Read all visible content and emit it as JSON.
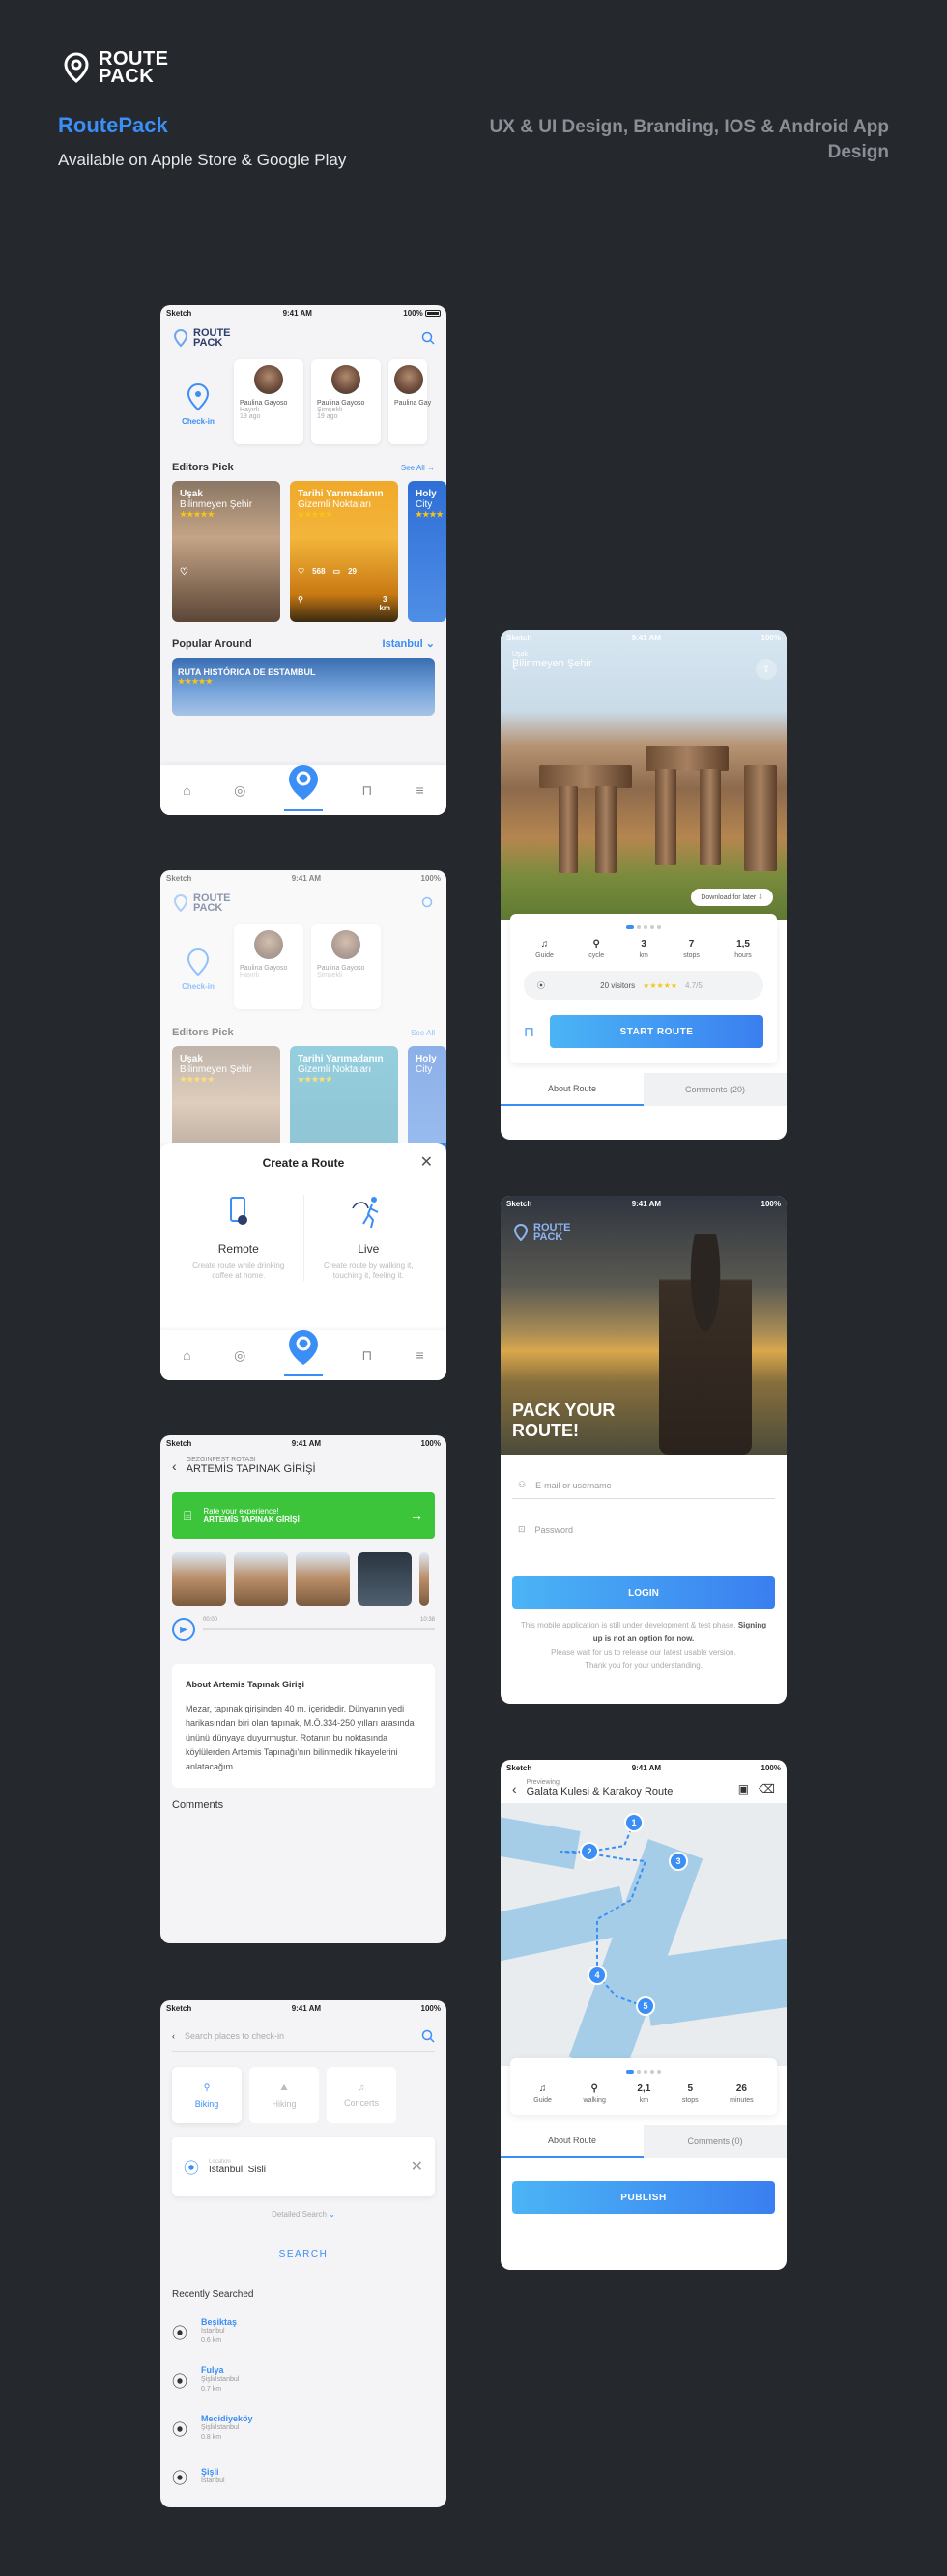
{
  "header": {
    "logo_line1": "ROUTE",
    "logo_line2": "PACK",
    "title": "RoutePack",
    "subtitle": "Available on Apple Store & Google Play",
    "right_text": "UX & UI Design, Branding, IOS & Android App Design"
  },
  "status": {
    "carrier": "Sketch",
    "time": "9:41 AM",
    "battery": "100%"
  },
  "home": {
    "logo_line1": "ROUTE",
    "logo_line2": "PACK",
    "checkin_label": "Check-in",
    "people": [
      {
        "name": "Paulina Gayoso",
        "sub": "Hayırlı",
        "meta": "19 ago"
      },
      {
        "name": "Paulina Gayoso",
        "sub": "Şimşekli",
        "meta": "19 ago"
      },
      {
        "name": "Paulina Gay",
        "sub": "",
        "meta": ""
      }
    ],
    "editors_title": "Editors Pick",
    "see_all": "See All",
    "editors": [
      {
        "title": "Uşak",
        "subtitle": "Bilinmeyen Şehir",
        "stars": "★★★★★",
        "likes": "",
        "comments": "",
        "km": ""
      },
      {
        "title": "Tarihi Yarımadanın",
        "subtitle": "Gizemli Noktaları",
        "stars": "★★★★★",
        "likes": "568",
        "comments": "29",
        "km": "3"
      },
      {
        "title": "Holy",
        "subtitle": "City",
        "stars": "★★★★",
        "likes": "",
        "comments": "",
        "km": ""
      }
    ],
    "km_unit": "km",
    "popular_title": "Popular Around",
    "popular_city": "Istanbul",
    "popular_card_title": "RUTA HISTÓRICA DE ESTAMBUL",
    "popular_stars": "★★★★★"
  },
  "create_route": {
    "title": "Create a Route",
    "remote_label": "Remote",
    "remote_desc": "Create route while drinking coffee at home.",
    "live_label": "Live",
    "live_desc": "Create route by walking it, touching it, feeling it."
  },
  "artemis": {
    "pre": "GEZGINFEST ROTASI",
    "title": "ARTEMİS TAPINAK GİRİŞİ",
    "rate_line1": "Rate your experience!",
    "rate_line2": "ARTEMİS TAPINAK GİRİŞİ",
    "time_start": "00:00",
    "time_end": "10:38",
    "about_title": "About Artemis Tapınak Girişi",
    "about_text": "Mezar, tapınak girişinden 40 m. içeridedir. Dünyanın yedi harikasından biri olan tapınak, M.Ö.334-250 yılları arasında ününü dünyaya duyurmuştur. Rotanın bu noktasında köylülerden Artemis Tapınağı'nın bilinmedik hikayelerini anlatacağım.",
    "comments": "Comments"
  },
  "search": {
    "placeholder": "Search places to check-in",
    "cats": [
      "Biking",
      "Hiking",
      "Concerts"
    ],
    "loc_label": "Location",
    "loc_value": "Istanbul, Sisli",
    "detailed": "Detailed Search",
    "search_btn": "SEARCH",
    "recent_title": "Recently Searched",
    "recent": [
      {
        "name": "Beşiktaş",
        "city": "İstanbul",
        "dist": "0.6 km"
      },
      {
        "name": "Fulya",
        "city": "Şişli/İstanbul",
        "dist": "0.7 km"
      },
      {
        "name": "Mecidiyeköy",
        "city": "Şişli/İstanbul",
        "dist": "0.8 km"
      },
      {
        "name": "Şişli",
        "city": "İstanbul",
        "dist": ""
      }
    ]
  },
  "detail": {
    "pre": "Uşak",
    "title": "Bilinmeyen Şehir",
    "download": "Download for later",
    "stats": [
      {
        "v": "",
        "l": "Guide"
      },
      {
        "v": "",
        "l": "cycle"
      },
      {
        "v": "3",
        "l": "km"
      },
      {
        "v": "7",
        "l": "stops"
      },
      {
        "v": "1,5",
        "l": "hours"
      }
    ],
    "visitors": "20 visitors",
    "rating_stars": "★★★★★",
    "rating": "4.7/5",
    "start": "START ROUTE",
    "tab1": "About Route",
    "tab2": "Comments (20)"
  },
  "login": {
    "logo_line1": "ROUTE",
    "logo_line2": "PACK",
    "headline1": "PACK YOUR",
    "headline2": "ROUTE!",
    "email_placeholder": "E-mail or username",
    "password_placeholder": "Password",
    "login_btn": "LOGIN",
    "note1": "This mobile application is still under development & test phase.",
    "note_bold": "Signing up is not an option for now.",
    "note2": "Please wait for us to release our latest usable version.",
    "note3": "Thank you for your understanding."
  },
  "preview": {
    "pre": "Previewing",
    "title": "Galata Kulesi & Karakoy Route",
    "markers": [
      "1",
      "2",
      "3",
      "4",
      "5"
    ],
    "stats": [
      {
        "v": "",
        "l": "Guide"
      },
      {
        "v": "",
        "l": "walking"
      },
      {
        "v": "2,1",
        "l": "km"
      },
      {
        "v": "5",
        "l": "stops"
      },
      {
        "v": "26",
        "l": "minutes"
      }
    ],
    "tab1": "About Route",
    "tab2": "Comments (0)",
    "publish": "PUBLISH"
  },
  "colors": {
    "accent": "#3a8ef6",
    "bg": "#25282d",
    "green": "#3cc53a",
    "star": "#f5c518"
  }
}
